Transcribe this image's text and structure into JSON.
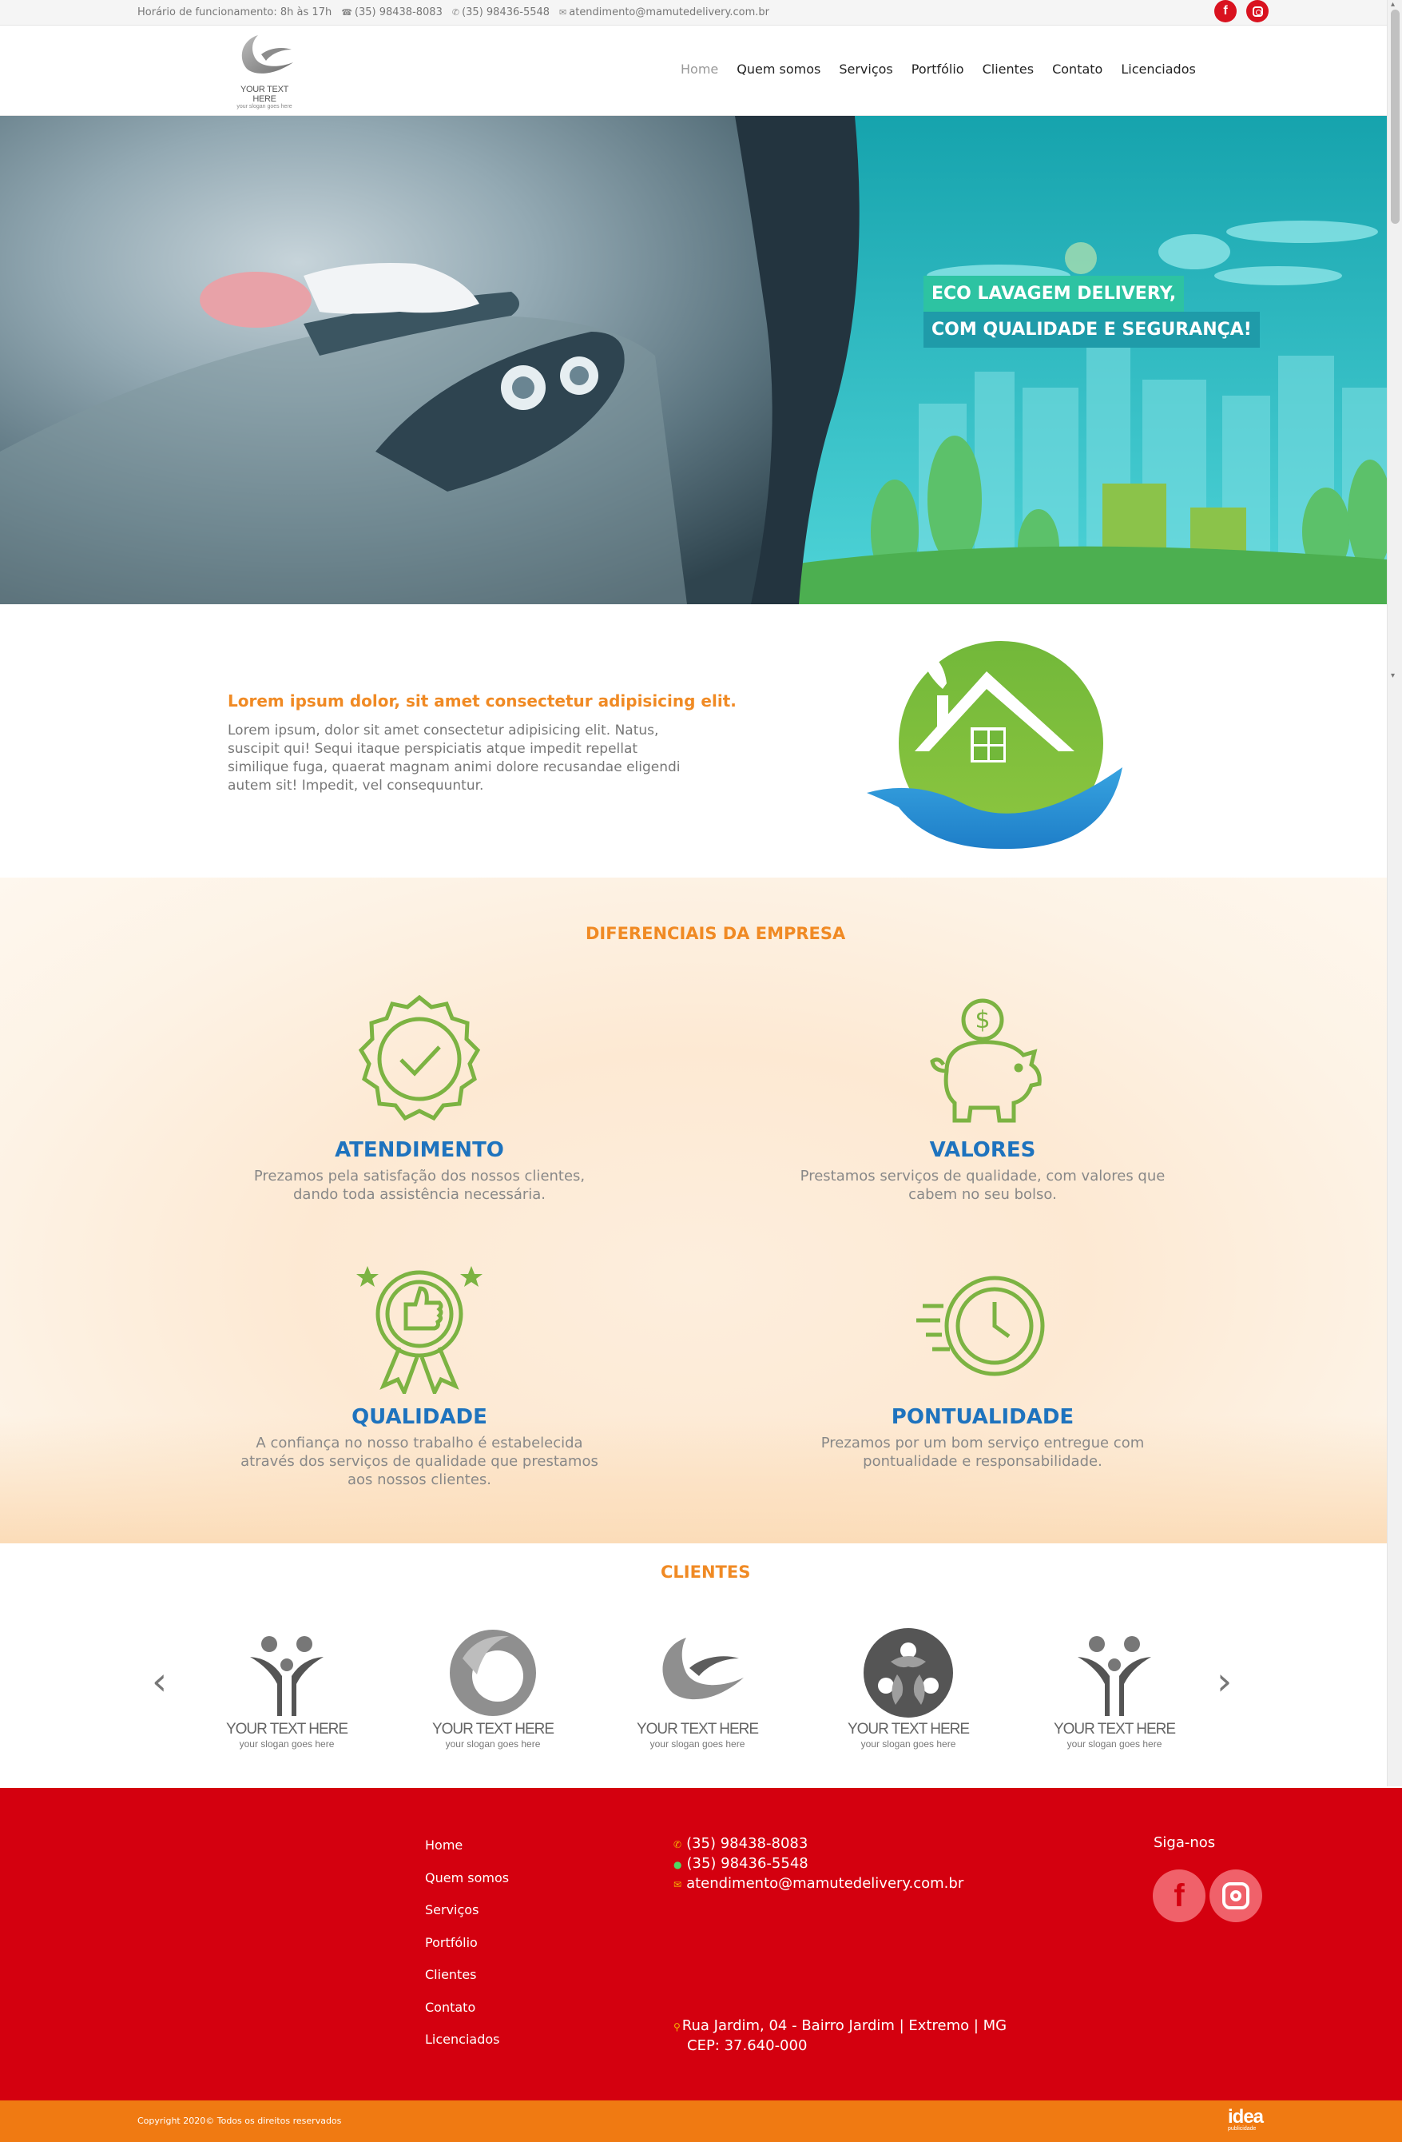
{
  "topbar": {
    "hours": "Horário de funcionamento: 8h às 17h",
    "phone": "(35) 98438-8083",
    "whatsapp": "(35) 98436-5548",
    "email": "atendimento@mamutedelivery.com.br"
  },
  "logo": {
    "name": "YOUR TEXT HERE",
    "slogan": "your slogan goes here"
  },
  "nav": {
    "items": [
      "Home",
      "Quem somos",
      "Serviços",
      "Portfólio",
      "Clientes",
      "Contato",
      "Licenciados"
    ],
    "active": "Home"
  },
  "hero": {
    "line1": "ECO LAVAGEM DELIVERY,",
    "line2": "COM QUALIDADE E SEGURANÇA!"
  },
  "intro": {
    "title": "Lorem ipsum dolor, sit amet consectetur adipisicing elit.",
    "text": "Lorem ipsum, dolor sit amet consectetur adipisicing elit. Natus, suscipit qui! Sequi itaque perspiciatis atque impedit repellat similique fuga, quaerat magnam animi dolore recusandae eligendi autem sit! Impedit, vel consequuntur."
  },
  "diferenciais": {
    "title": "DIFERENCIAIS DA EMPRESA",
    "items": [
      {
        "title": "ATENDIMENTO",
        "text": "Prezamos pela satisfação dos nossos clientes, dando toda assistência necessária.",
        "icon": "certified-badge-icon"
      },
      {
        "title": "VALORES",
        "text": "Prestamos serviços de qualidade, com valores que cabem no seu bolso.",
        "icon": "piggy-bank-icon"
      },
      {
        "title": "QUALIDADE",
        "text": "A confiança no nosso trabalho é estabelecida através dos serviços de qualidade que prestamos aos nossos clientes.",
        "icon": "thumbs-up-medal-icon"
      },
      {
        "title": "PONTUALIDADE",
        "text": "Prezamos por um bom serviço entregue com pontualidade e responsabilidade.",
        "icon": "fast-clock-icon"
      }
    ]
  },
  "clientes": {
    "title": "CLIENTES",
    "items": [
      {
        "name": "YOUR TEXT HERE",
        "slogan": "your slogan goes here"
      },
      {
        "name": "YOUR TEXT HERE",
        "slogan": "your slogan goes here"
      },
      {
        "name": "YOUR TEXT HERE",
        "slogan": "your slogan goes here"
      },
      {
        "name": "YOUR TEXT HERE",
        "slogan": "your slogan goes here"
      },
      {
        "name": "YOUR TEXT HERE",
        "slogan": "your slogan goes here"
      }
    ]
  },
  "footer": {
    "nav": [
      "Home",
      "Quem somos",
      "Serviços",
      "Portfólio",
      "Clientes",
      "Contato",
      "Licenciados"
    ],
    "phone": "(35) 98438-8083",
    "whatsapp": "(35) 98436-5548",
    "email": "atendimento@mamutedelivery.com.br",
    "address_line1": "Rua Jardim, 04 - Bairro Jardim | Extremo | MG",
    "address_line2": "CEP: 37.640-000",
    "follow": "Siga-nos"
  },
  "copyright": {
    "text": "Copyright 2020© Todos os direitos reservados",
    "brand": "idea",
    "brand_sub": "publicidade"
  },
  "colors": {
    "accent_orange": "#f08a24",
    "feature_blue": "#1e73be",
    "icon_green": "#7cb342",
    "footer_red": "#d4000f",
    "copyright_orange": "#f07a12"
  }
}
